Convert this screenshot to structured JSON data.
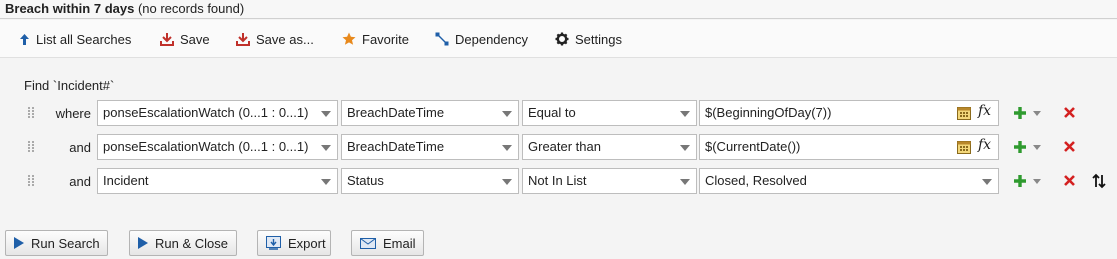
{
  "title": {
    "name": "Breach within 7 days",
    "status": "(no records found)"
  },
  "toolbar": {
    "list_all": "List all Searches",
    "save": "Save",
    "save_as": "Save as...",
    "favorite": "Favorite",
    "dependency": "Dependency",
    "settings": "Settings"
  },
  "query": {
    "find_label": "Find `Incident#`",
    "rows": [
      {
        "keyword": "where",
        "object": "ponseEscalationWatch (0...1 : 0...1)",
        "field": "BreachDateTime",
        "operator": "Equal to",
        "value": "$(BeginningOfDay(7))",
        "value_type": "text"
      },
      {
        "keyword": "and",
        "object": "ponseEscalationWatch (0...1 : 0...1)",
        "field": "BreachDateTime",
        "operator": "Greater than",
        "value": "$(CurrentDate())",
        "value_type": "text"
      },
      {
        "keyword": "and",
        "object": "Incident",
        "field": "Status",
        "operator": "Not In List",
        "value": "Closed, Resolved",
        "value_type": "list"
      }
    ],
    "fx_label": "fx"
  },
  "buttons": {
    "run_search": "Run Search",
    "run_close": "Run & Close",
    "export": "Export",
    "email": "Email"
  },
  "colors": {
    "accent_blue": "#1f5fa8",
    "save_red": "#c0302a",
    "add_green": "#2e9a2e",
    "delete_red": "#d42020",
    "star_orange": "#e8891c"
  },
  "icons": [
    "arrow-up-icon",
    "save-icon",
    "save-as-icon",
    "star-icon",
    "dependency-icon",
    "gear-icon",
    "calendar-icon",
    "fx-icon",
    "add-icon",
    "delete-icon",
    "sort-icon",
    "play-icon",
    "export-icon",
    "email-icon"
  ]
}
